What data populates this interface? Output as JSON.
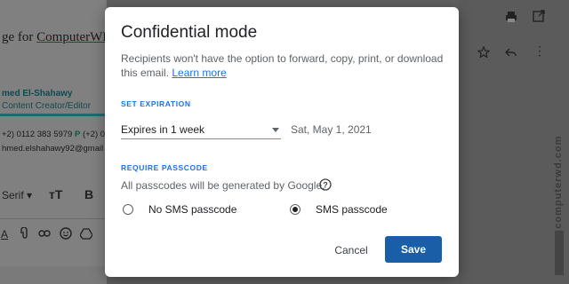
{
  "background": {
    "subject_prefix": "ge for ",
    "subject_link": "ComputerWD",
    "signature_name": "med El-Shahawy",
    "signature_role": "Content Creator/Editor",
    "phone_prefix": "+2) 0112 383 5979",
    "phone_p": "P",
    "phone_suffix": "(+2) 0",
    "email": "hmed.elshahawy92@gmail",
    "font_name": "Serif",
    "watermark": "www.computerwd.com"
  },
  "dialog": {
    "title": "Confidential mode",
    "description": "Recipients won't have the option to forward, copy, print, or download this email.",
    "learn_more": "Learn more",
    "set_expiration_label": "SET EXPIRATION",
    "expiration_value": "Expires in 1 week",
    "expiration_date": "Sat, May 1, 2021",
    "require_passcode_label": "REQUIRE PASSCODE",
    "passcode_note": "All passcodes will be generated by Google.",
    "options": [
      {
        "label": "No SMS passcode",
        "selected": false
      },
      {
        "label": "SMS passcode",
        "selected": true
      }
    ],
    "cancel_label": "Cancel",
    "save_label": "Save"
  },
  "colors": {
    "accent": "#1a73e8",
    "save_button": "#1a5ea8",
    "overlay": "#5f5f5f"
  }
}
